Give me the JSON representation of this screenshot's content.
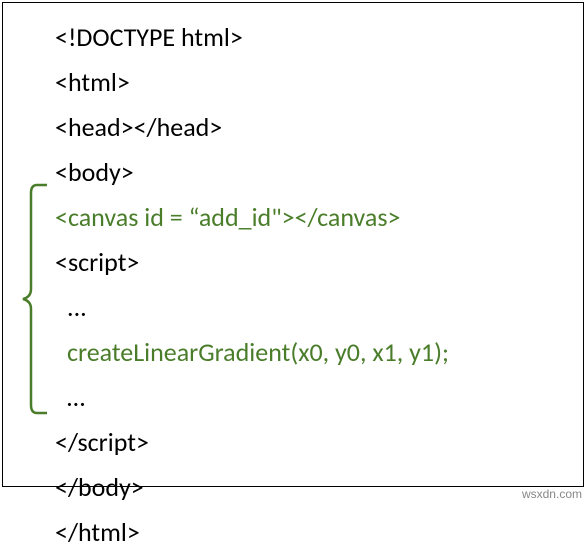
{
  "code": {
    "line1": "<!DOCTYPE html>",
    "line2": "<html>",
    "line3": "<head></head>",
    "line4": "<body>",
    "line5": "<canvas id = “add_id\"></canvas>",
    "line6": "<script>",
    "line7": "...",
    "line8": "createLinearGradient(x0, y0, x1, y1);",
    "line9": "…",
    "line10": "</script>",
    "line11": "</body>",
    "line12": "</html>"
  },
  "watermark": "wsxdn.com"
}
